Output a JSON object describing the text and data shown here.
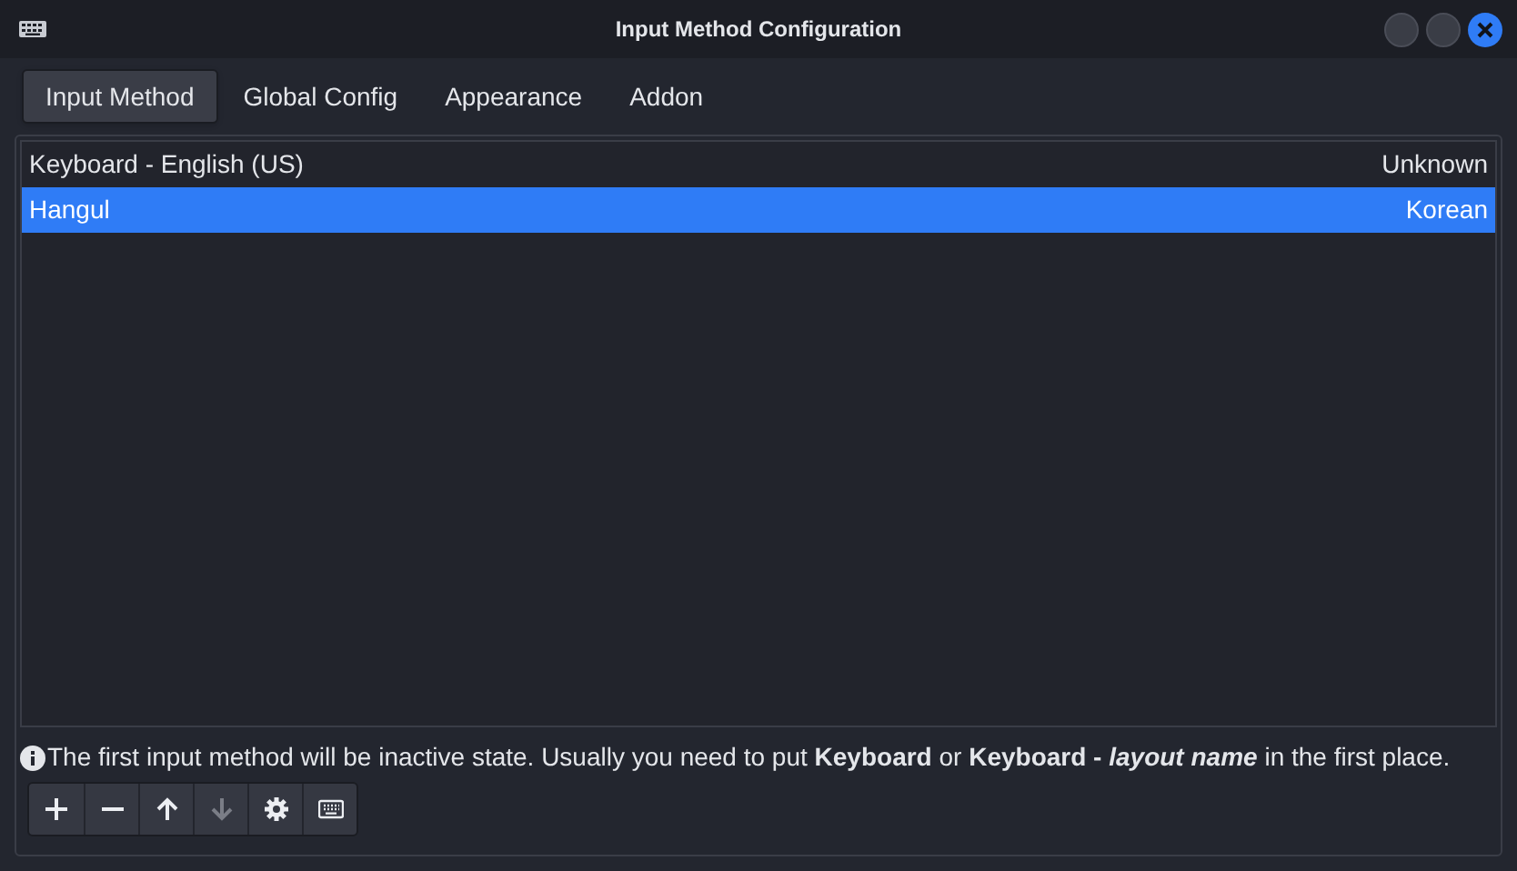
{
  "window": {
    "title": "Input Method Configuration"
  },
  "tabs": [
    {
      "label": "Input Method",
      "selected": true
    },
    {
      "label": "Global Config",
      "selected": false
    },
    {
      "label": "Appearance",
      "selected": false
    },
    {
      "label": "Addon",
      "selected": false
    }
  ],
  "input_methods": [
    {
      "name": "Keyboard - English (US)",
      "language": "Unknown",
      "selected": false
    },
    {
      "name": "Hangul",
      "language": "Korean",
      "selected": true
    }
  ],
  "hint": "The first input method will be inactive state. Usually you need to put **Keyboard** or **Keyboard -** *layout name* in the first place.",
  "toolbar": [
    {
      "kind": "add",
      "disabled": false
    },
    {
      "kind": "remove",
      "disabled": false
    },
    {
      "kind": "up",
      "disabled": false
    },
    {
      "kind": "down",
      "disabled": true
    },
    {
      "kind": "configure",
      "disabled": false
    },
    {
      "kind": "layout",
      "disabled": false
    }
  ]
}
